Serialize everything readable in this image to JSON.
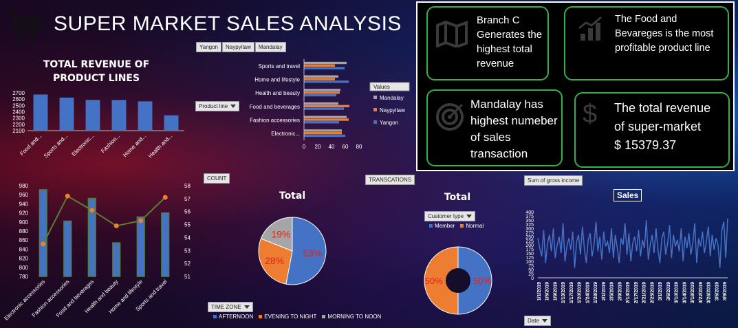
{
  "header": {
    "title": "SUPER MARKET SALES ANALYSIS"
  },
  "city_slicer": [
    "Yangon",
    "Naypyitaw",
    "Mandalay"
  ],
  "buttons": {
    "product_line": "Product line",
    "count": "COUNT",
    "transactions": "TRANSCATIONS",
    "gross_income": "Sum of gross income",
    "time_zone": "TIME ZONE",
    "customer_type": "Customer type",
    "date": "Date"
  },
  "insights": {
    "card1": [
      "Branch C",
      "Generates the",
      "highest total",
      "revenue"
    ],
    "card2": [
      "The Food and",
      "Bevareges is the most",
      "profitable product line"
    ],
    "card3": [
      "Mandalay has",
      "highest numeber",
      "of sales",
      "transaction"
    ],
    "card4": [
      "The total revenue",
      "of super-market",
      "$ 15379.37"
    ]
  },
  "colors": {
    "blue": "#4472c4",
    "orange": "#ed7d31",
    "gray": "#a5a5a5",
    "green": "#548235",
    "card_border": "#2fb34a"
  },
  "chart_data": [
    {
      "id": "revenue",
      "type": "bar",
      "title": "TOTAL REVENUE OF PRODUCT LINES",
      "categories": [
        "Food and...",
        "Sports and...",
        "Electronic...",
        "Fashion...",
        "Home and...",
        "Health and..."
      ],
      "values": [
        2673,
        2624,
        2588,
        2586,
        2565,
        2343
      ],
      "ylim": [
        2100,
        2700
      ],
      "yticks": [
        2100,
        2200,
        2300,
        2400,
        2500,
        2600,
        2700
      ]
    },
    {
      "id": "city_bars",
      "type": "bar",
      "orientation": "horizontal",
      "categories": [
        "Sports and travel",
        "Home and lifestyle",
        "Health and beauty",
        "Food and beverages",
        "Fashion accessories",
        "Electronic..."
      ],
      "legend_title": "Values",
      "series": [
        {
          "name": "Mandalay",
          "values": [
            62,
            50,
            53,
            50,
            62,
            55
          ]
        },
        {
          "name": "Naypyitaw",
          "values": [
            45,
            45,
            52,
            66,
            65,
            55
          ]
        },
        {
          "name": "Yangon",
          "values": [
            59,
            65,
            47,
            58,
            51,
            60
          ]
        }
      ],
      "xlim": [
        0,
        80
      ],
      "xticks": [
        0,
        20,
        40,
        60,
        80
      ]
    },
    {
      "id": "combo",
      "type": "bar",
      "categories": [
        "Electronic accessories",
        "Fashion accessories",
        "Food and beverages",
        "Health and beauty",
        "Home and lifestyle",
        "Sports and travel"
      ],
      "series": [
        {
          "name": "",
          "type": "bar",
          "axis": "left",
          "values": [
            971,
            902,
            952,
            854,
            911,
            920
          ]
        },
        {
          "name": "",
          "type": "line",
          "axis": "right",
          "values": [
            53.5,
            57.2,
            56.1,
            54.9,
            55.3,
            57.1
          ]
        }
      ],
      "ylim": [
        780,
        980
      ],
      "yticks": [
        780,
        800,
        820,
        840,
        860,
        880,
        900,
        920,
        940,
        960,
        980
      ],
      "y2lim": [
        51,
        58
      ],
      "y2ticks": [
        51,
        52,
        53,
        54,
        55,
        56,
        57,
        58
      ]
    },
    {
      "id": "time_zone_pie",
      "type": "pie",
      "title": "Total",
      "labels": [
        "AFTERNOON",
        "EVENING TO NIGHT",
        "MORNING TO NOON"
      ],
      "values": [
        53,
        28,
        19
      ],
      "value_labels": [
        "53%",
        "28%",
        "19%"
      ]
    },
    {
      "id": "customer_donut",
      "type": "pie",
      "title": "Total",
      "labels": [
        "Member",
        "Normal"
      ],
      "values": [
        50,
        50
      ],
      "value_labels": [
        "50%",
        "50%"
      ]
    },
    {
      "id": "sales_line",
      "type": "line",
      "title": "Sales",
      "x_tick_labels": [
        "1/1/2019",
        "1/5/2019",
        "1/9/2019",
        "1/13/2019",
        "1/17/2019",
        "1/20/2019",
        "1/24/2019",
        "1/28/2019",
        "2/1/2019",
        "2/5/2019",
        "2/9/2019",
        "2/13/2019",
        "2/17/2019",
        "2/21/2019",
        "2/25/2019",
        "3/1/2019",
        "3/6/2019",
        "3/10/2019",
        "3/14/2019",
        "3/18/2019",
        "3/22/2019",
        "3/26/2019",
        "3/5/2019",
        "3/9/2019"
      ],
      "values": [
        240,
        180,
        130,
        290,
        90,
        210,
        260,
        160,
        300,
        120,
        200,
        250,
        150,
        330,
        100,
        190,
        240,
        170,
        280,
        60,
        220,
        260,
        140,
        310,
        180,
        90,
        230,
        270,
        130,
        200,
        340,
        160,
        250,
        110,
        280,
        190,
        220,
        150,
        300,
        120,
        260,
        180,
        90,
        240,
        200,
        330,
        140,
        270,
        100,
        210,
        250,
        160,
        290,
        130,
        230,
        180,
        350,
        110,
        200,
        260,
        150,
        300,
        170,
        90,
        240,
        280,
        140,
        210,
        320,
        120,
        260,
        190,
        230,
        160,
        300,
        100,
        250,
        180,
        270,
        140,
        210,
        330,
        90,
        240,
        190,
        280,
        150,
        220,
        310,
        130,
        260,
        170,
        240,
        200,
        60,
        290,
        340,
        120,
        360
      ],
      "ylim": [
        0,
        400
      ],
      "yticks": [
        0,
        25,
        50,
        75,
        100,
        125,
        150,
        175,
        200,
        225,
        250,
        275,
        300,
        325,
        350,
        375,
        400
      ]
    }
  ]
}
